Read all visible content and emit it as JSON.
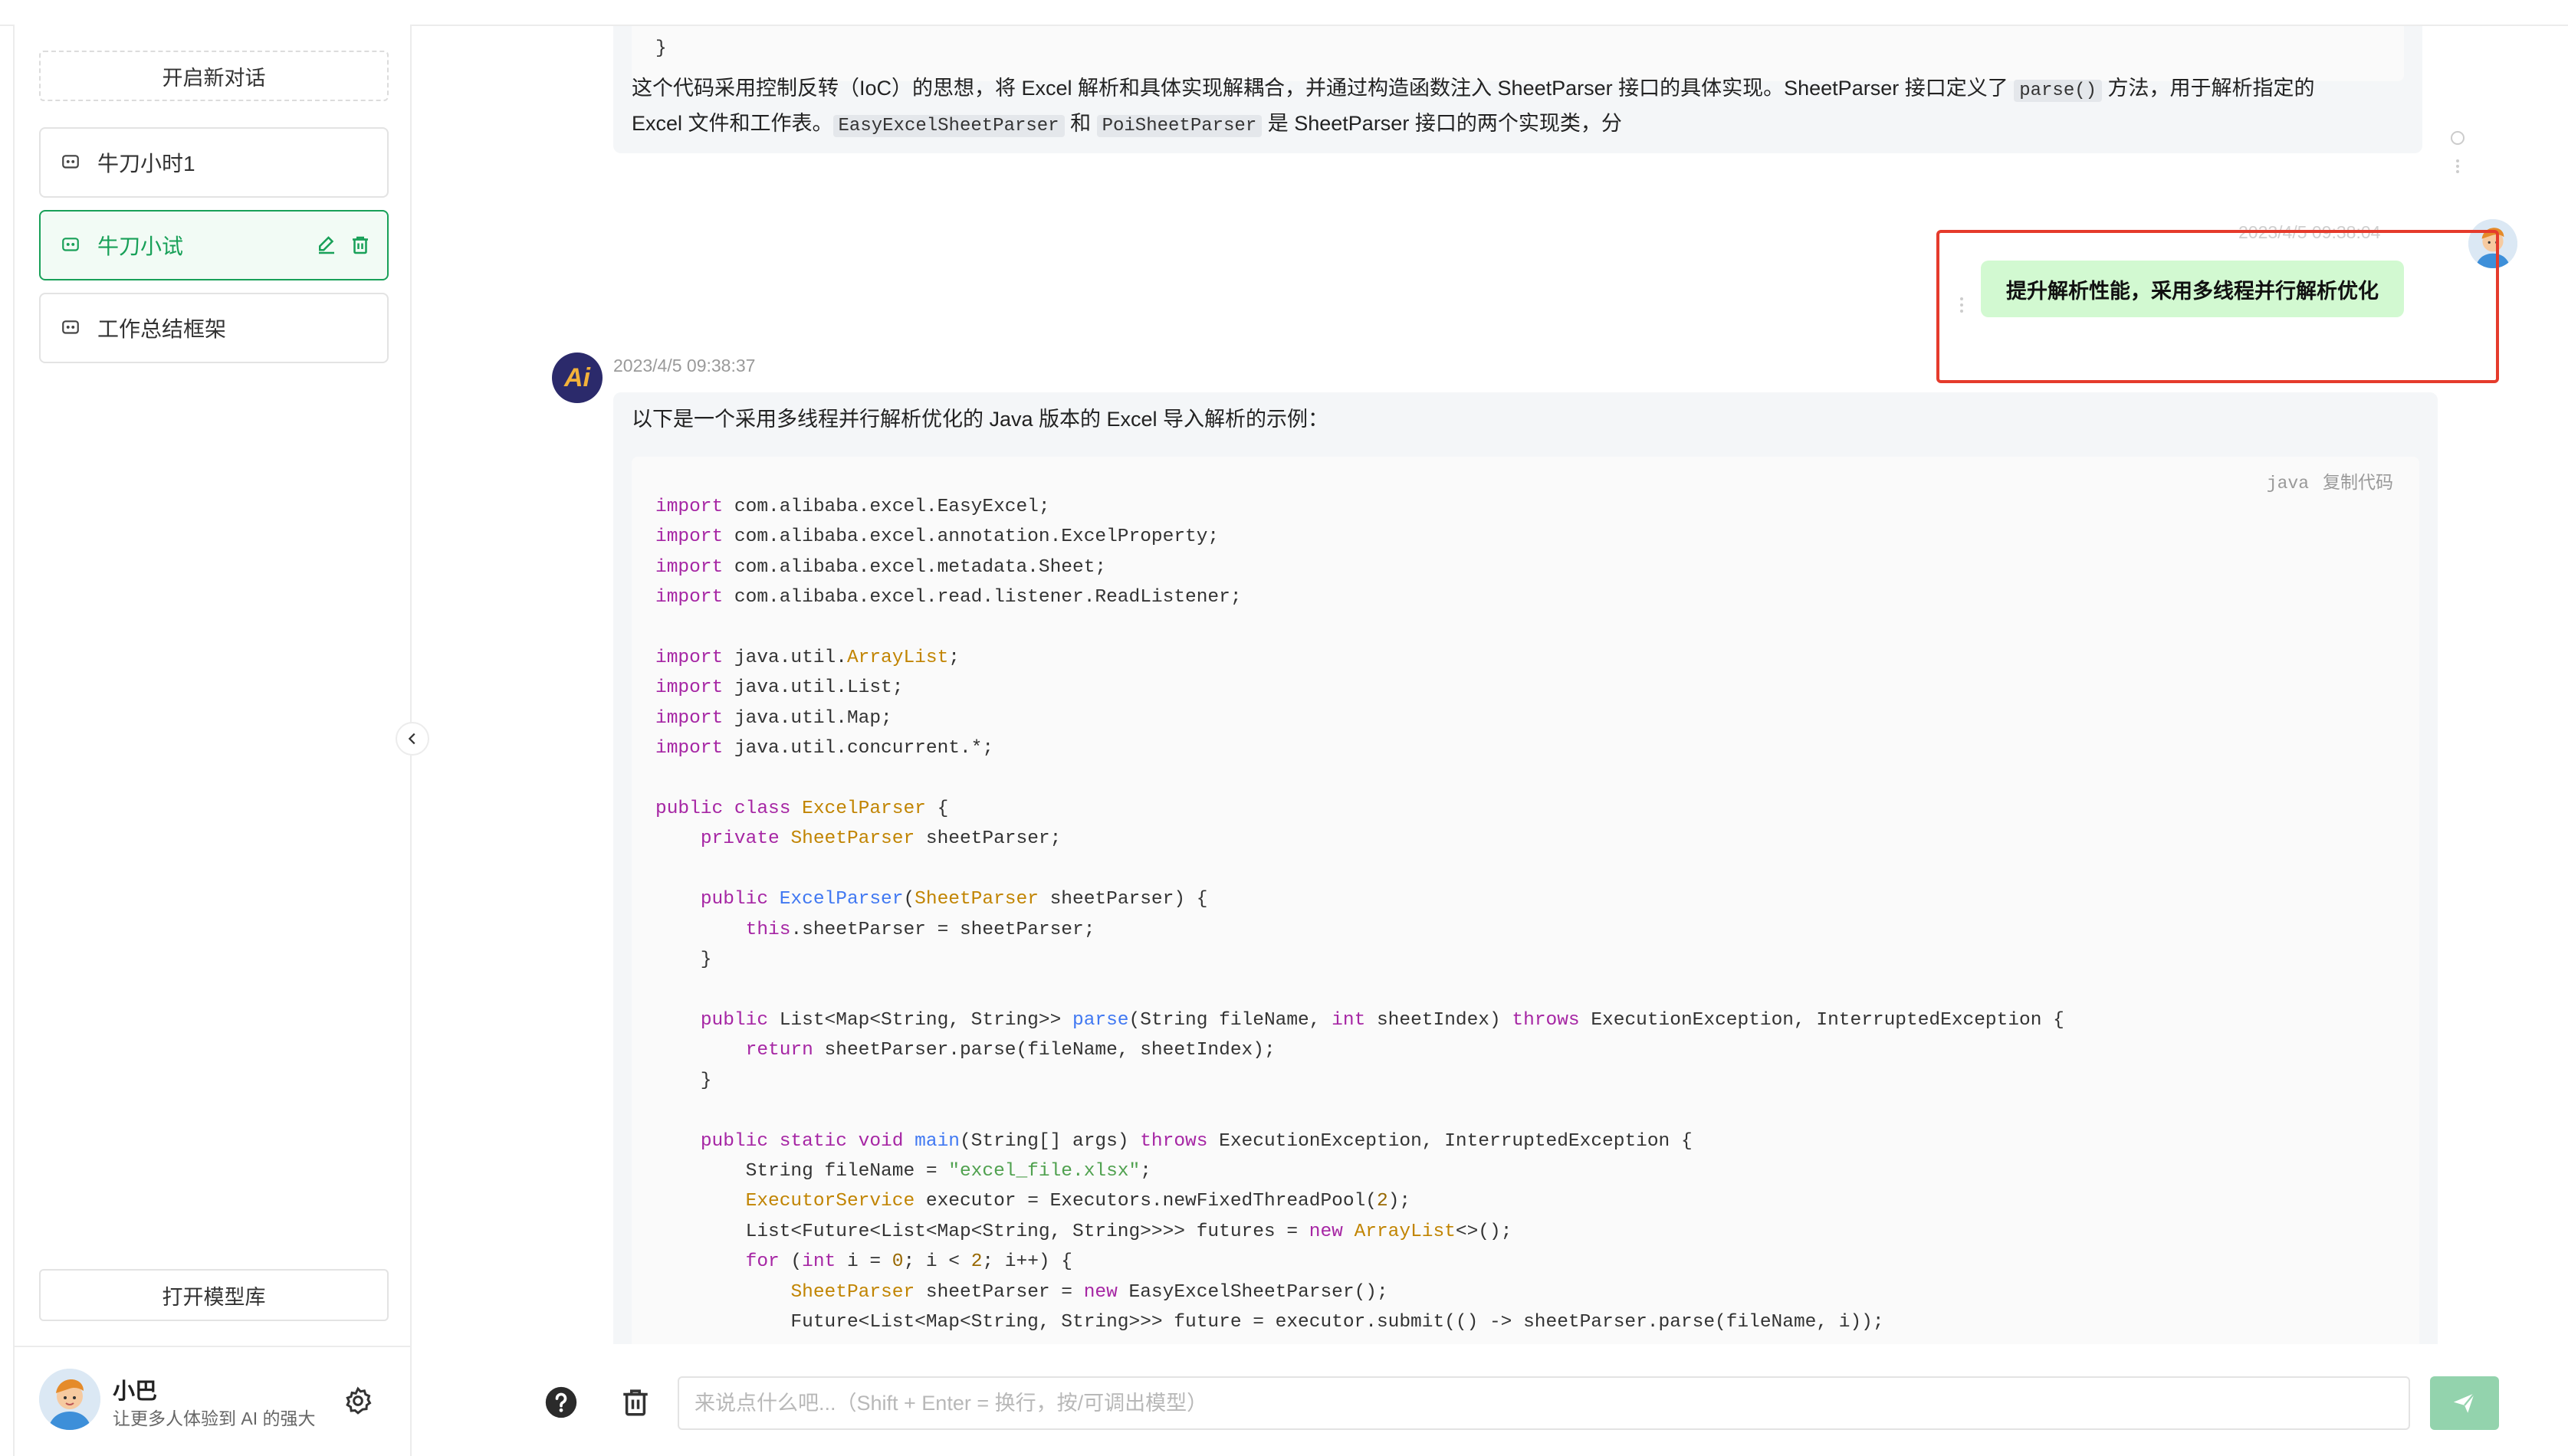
{
  "sidebar": {
    "new_chat_label": "开启新对话",
    "conversations": [
      {
        "label": "牛刀小时1",
        "active": false
      },
      {
        "label": "牛刀小试",
        "active": true
      },
      {
        "label": "工作总结框架",
        "active": false
      }
    ],
    "open_model_library_label": "打开模型库",
    "user": {
      "name": "小巴",
      "description": "让更多人体验到 AI 的强大"
    }
  },
  "messages": {
    "prev_bot": {
      "closing_brace": "}",
      "text_1": "这个代码采用控制反转（IoC）的思想，将 Excel 解析和具体实现解耦合，并通过构造函数注入 SheetParser 接口的具体实现。SheetParser 接口定义了 ",
      "code_parse": "parse()",
      "text_2": " 方法，用于解析指定的",
      "text_3": "Excel 文件和工作表。",
      "code_easy": "EasyExcelSheetParser",
      "text_4": " 和 ",
      "code_poi": "PoiSheetParser",
      "text_5": " 是 SheetParser 接口的两个实现类，分"
    },
    "user_msg": {
      "timestamp": "2023/4/5 09:38:04",
      "text": "提升解析性能，采用多线程并行解析优化"
    },
    "bot_reply": {
      "avatar_text": "Ai",
      "timestamp": "2023/4/5 09:38:37",
      "intro": "以下是一个采用多线程并行解析优化的 Java 版本的 Excel 导入解析的示例：",
      "code_lang": "java",
      "copy_label": "复制代码",
      "code_lines": [
        "import com.alibaba.excel.EasyExcel;",
        "import com.alibaba.excel.annotation.ExcelProperty;",
        "import com.alibaba.excel.metadata.Sheet;",
        "import com.alibaba.excel.read.listener.ReadListener;",
        "",
        "import java.util.ArrayList;",
        "import java.util.List;",
        "import java.util.Map;",
        "import java.util.concurrent.*;",
        "",
        "public class ExcelParser {",
        "    private SheetParser sheetParser;",
        "",
        "    public ExcelParser(SheetParser sheetParser) {",
        "        this.sheetParser = sheetParser;",
        "    }",
        "",
        "    public List<Map<String, String>> parse(String fileName, int sheetIndex) throws ExecutionException, InterruptedException {",
        "        return sheetParser.parse(fileName, sheetIndex);",
        "    }",
        "",
        "    public static void main(String[] args) throws ExecutionException, InterruptedException {",
        "        String fileName = \"excel_file.xlsx\";",
        "        ExecutorService executor = Executors.newFixedThreadPool(2);",
        "        List<Future<List<Map<String, String>>>> futures = new ArrayList<>();",
        "        for (int i = 0; i < 2; i++) {",
        "            SheetParser sheetParser = new EasyExcelSheetParser();",
        "            Future<List<Map<String, String>>> future = executor.submit(() -> sheetParser.parse(fileName, i));"
      ]
    }
  },
  "input": {
    "placeholder": "来说点什么吧...（Shift + Enter = 换行，按/可调出模型）",
    "value": ""
  },
  "colors": {
    "accent": "#18a058",
    "user_bubble": "#d2f9d1",
    "highlight": "#e53b2c",
    "send_button": "#93d3ad"
  },
  "icons": [
    "chat-bubble-icon",
    "edit-icon",
    "trash-icon",
    "gear-icon",
    "chevron-left-icon",
    "help-icon",
    "send-icon"
  ]
}
